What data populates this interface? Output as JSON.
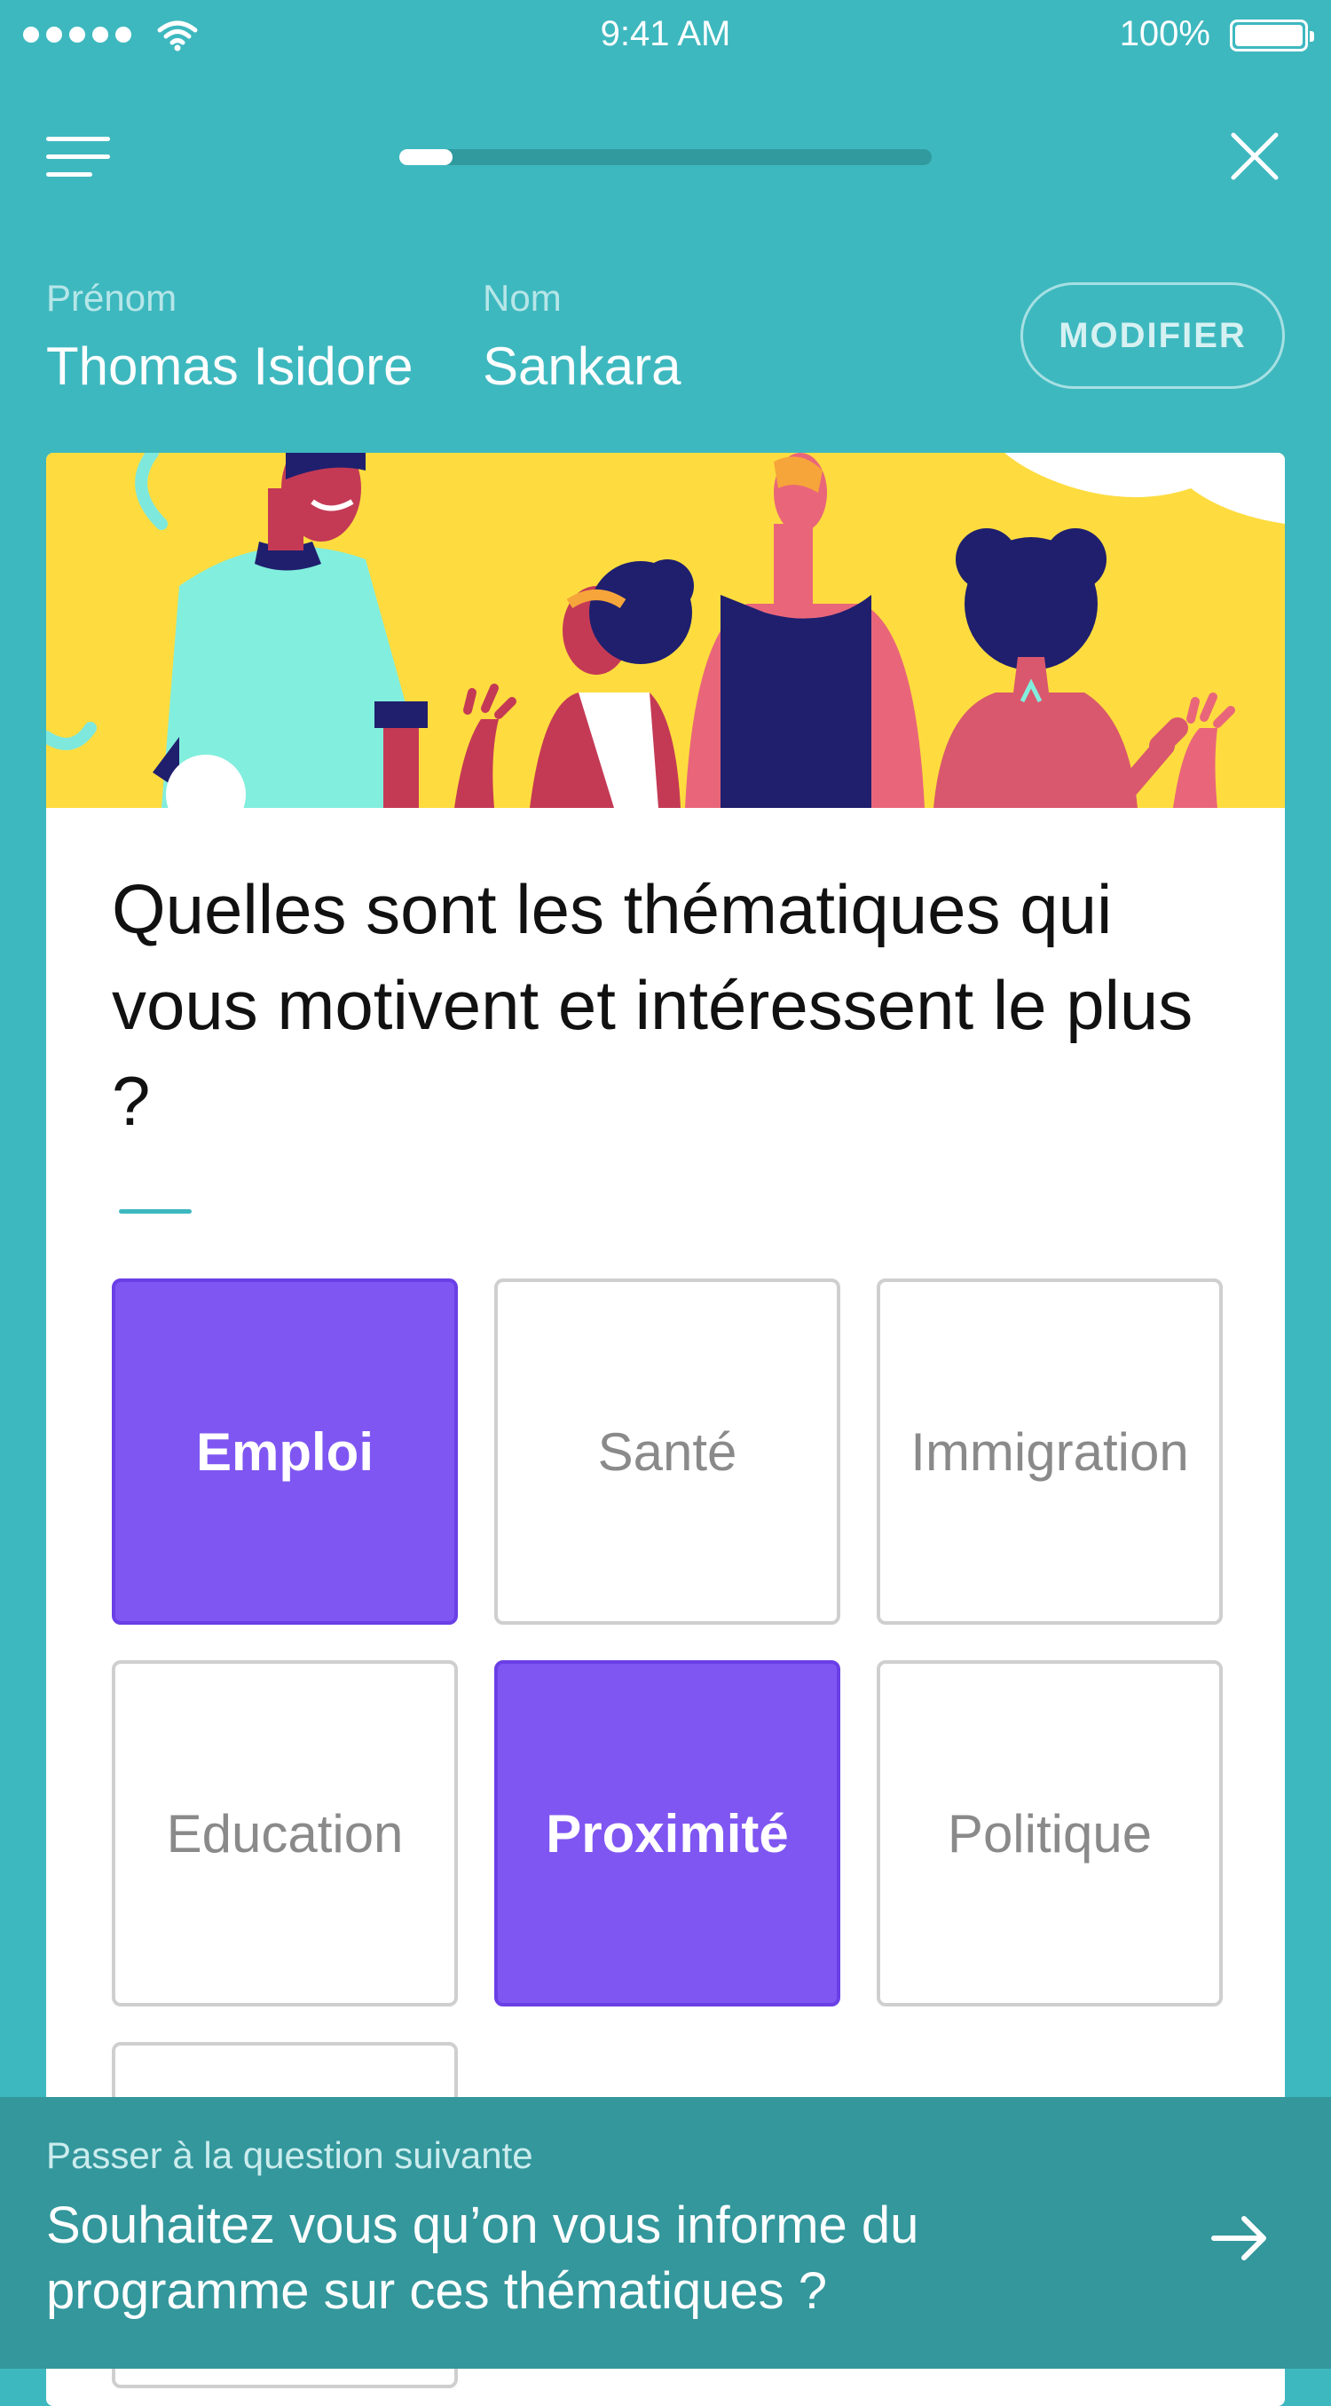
{
  "status_bar": {
    "time": "9:41 AM",
    "battery": "100%"
  },
  "nav": {
    "progress": 0.1
  },
  "profile": {
    "first_name_label": "Prénom",
    "first_name": "Thomas Isidore",
    "last_name_label": "Nom",
    "last_name": "Sankara",
    "modify_label": "MODIFIER"
  },
  "question": {
    "text": "Quelles sont les thématiques qui vous motivent et intéressent le plus ?"
  },
  "options": [
    {
      "label": "Emploi",
      "selected": true
    },
    {
      "label": "Santé",
      "selected": false
    },
    {
      "label": "Immigration",
      "selected": false
    },
    {
      "label": "Education",
      "selected": false
    },
    {
      "label": "Proximité",
      "selected": true
    },
    {
      "label": "Politique",
      "selected": false
    },
    {
      "label": "",
      "selected": false
    }
  ],
  "footer": {
    "hint": "Passer à la question suivante",
    "next_question": "Souhaitez vous qu’on vous informe du programme sur ces thématiques ?"
  },
  "colors": {
    "background": "#3eb8bf",
    "selected": "#7f56f2",
    "footer": "#33979c"
  }
}
